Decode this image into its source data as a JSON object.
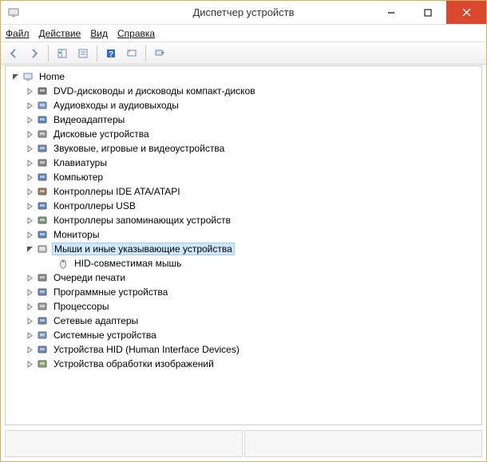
{
  "window": {
    "title": "Диспетчер устройств"
  },
  "menu": {
    "file": "Файл",
    "action": "Действие",
    "view": "Вид",
    "help": "Справка"
  },
  "tree": {
    "root": "Home",
    "items": [
      {
        "label": "DVD-дисководы и дисководы компакт-дисков"
      },
      {
        "label": "Аудиовходы и аудиовыходы"
      },
      {
        "label": "Видеоадаптеры"
      },
      {
        "label": "Дисковые устройства"
      },
      {
        "label": "Звуковые, игровые и видеоустройства"
      },
      {
        "label": "Клавиатуры"
      },
      {
        "label": "Компьютер"
      },
      {
        "label": "Контроллеры IDE ATA/ATAPI"
      },
      {
        "label": "Контроллеры USB"
      },
      {
        "label": "Контроллеры запоминающих устройств"
      },
      {
        "label": "Мониторы"
      },
      {
        "label": "Мыши и иные указывающие устройства",
        "expanded": true,
        "selected": true,
        "children": [
          {
            "label": "HID-совместимая мышь"
          }
        ]
      },
      {
        "label": "Очереди печати"
      },
      {
        "label": "Программные устройства"
      },
      {
        "label": "Процессоры"
      },
      {
        "label": "Сетевые адаптеры"
      },
      {
        "label": "Системные устройства"
      },
      {
        "label": "Устройства HID (Human Interface Devices)"
      },
      {
        "label": "Устройства обработки изображений"
      }
    ]
  }
}
